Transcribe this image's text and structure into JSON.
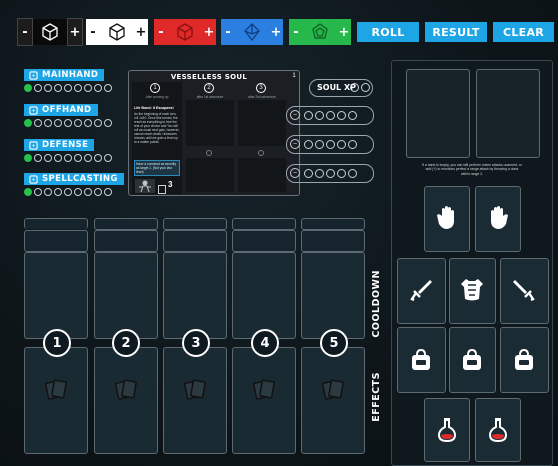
{
  "toolbar": {
    "dice": [
      {
        "name": "black",
        "color": "#111111",
        "minus": "-",
        "plus": "+"
      },
      {
        "name": "white",
        "color": "#ffffff",
        "minus": "-",
        "plus": "+"
      },
      {
        "name": "red",
        "color": "#e02a2a",
        "minus": "-",
        "plus": "+"
      },
      {
        "name": "blue",
        "color": "#2a7fe0",
        "minus": "-",
        "plus": "+"
      },
      {
        "name": "green",
        "color": "#26b84a",
        "minus": "-",
        "plus": "+"
      }
    ],
    "roll_label": "ROLL",
    "result_label": "RESULT",
    "clear_label": "CLEAR",
    "accent": "#1ea5e6"
  },
  "skills": [
    {
      "label": "MAINHAND",
      "filled": 1,
      "total": 9
    },
    {
      "label": "OFFHAND",
      "filled": 1,
      "total": 9
    },
    {
      "label": "DEFENSE",
      "filled": 1,
      "total": 9
    },
    {
      "label": "SPELLCASTING",
      "filled": 1,
      "total": 9
    }
  ],
  "soul_card": {
    "title": "VESSELLESS SOUL",
    "corner_num": "1",
    "cols": [
      "1",
      "2",
      "3"
    ],
    "col_sub": [
      "After pruning up",
      "after 1st adventure",
      "after 2nd adventure"
    ],
    "intro": "Life Bond: It Escapees!",
    "body": "As the beginning of each turn, roll 1d10. Once this turned, the result as everything to free the rest of your choice and You will roll as usual next gain, however, cannot reach deals / treasures choices until we gain a level up to a matter points.",
    "box": "Have a construct as security as target 1. (Not your last level)",
    "count": "3"
  },
  "soul_xp": {
    "label": "SOUL XP"
  },
  "right_panel": {
    "note": "If a hand is empty, you can still perform melee attacks unarmed, or add (+) to emotions perfect a range attack by throwing a dona within range 2."
  },
  "sections": {
    "cooldown": "COOLDOWN",
    "effects": "EFFECTS"
  },
  "ability_slots": [
    "1",
    "2",
    "3",
    "4",
    "5"
  ],
  "equipment_icons": [
    "hand-left-icon",
    "hand-right-icon",
    "sword-icon",
    "armor-icon",
    "sword-icon",
    "backpack-icon",
    "backpack-icon",
    "backpack-icon",
    "potion-icon",
    "potion-icon"
  ]
}
